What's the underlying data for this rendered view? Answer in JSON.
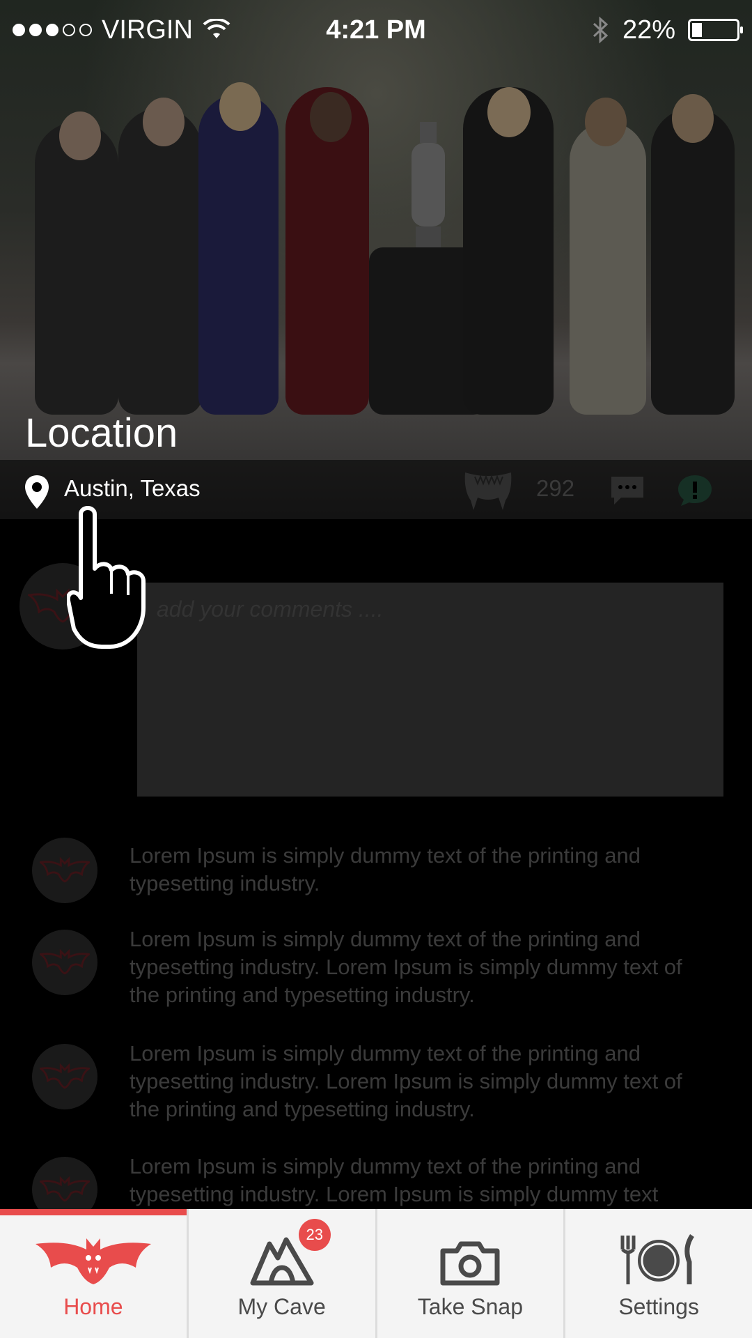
{
  "status_bar": {
    "carrier": "VIRGIN",
    "time": "4:21 PM",
    "battery": "22%",
    "signal_icon": "signal-dots-icon",
    "wifi_icon": "wifi-icon",
    "bluetooth_icon": "bluetooth-icon"
  },
  "hero": {
    "title": "Location",
    "location": "Austin, Texas",
    "fang_count": "292",
    "colors": {
      "accent": "#e84c4c",
      "alert": "#1e3b30"
    }
  },
  "composer": {
    "placeholder": "add your comments ...."
  },
  "comments": [
    {
      "text": "Lorem Ipsum is simply dummy text of the printing and typesetting industry."
    },
    {
      "text": "Lorem Ipsum is simply dummy text of the printing and typesetting industry. Lorem Ipsum is simply dummy text of the printing and typesetting industry."
    },
    {
      "text": "Lorem Ipsum is simply dummy text of the printing and typesetting industry. Lorem Ipsum is simply dummy text of the printing and typesetting industry."
    },
    {
      "text": "Lorem Ipsum is simply dummy text of the printing and typesetting industry. Lorem Ipsum is simply dummy text"
    }
  ],
  "tabbar": {
    "tabs": [
      {
        "label": "Home",
        "icon": "bat-icon",
        "active": true
      },
      {
        "label": "My Cave",
        "icon": "cave-icon",
        "badge": "23"
      },
      {
        "label": "Take Snap",
        "icon": "camera-icon"
      },
      {
        "label": "Settings",
        "icon": "fork-plate-knife-icon"
      }
    ]
  }
}
